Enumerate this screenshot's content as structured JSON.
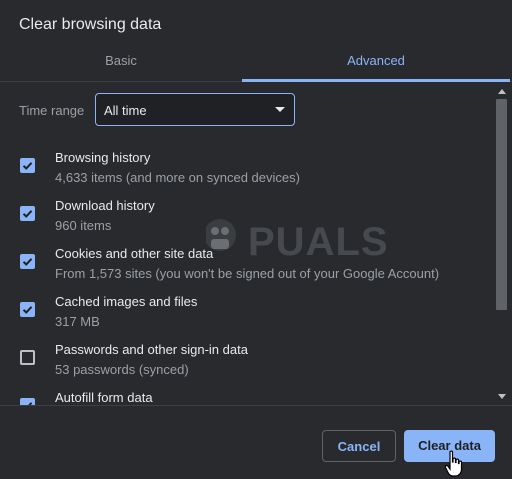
{
  "dialog": {
    "title": "Clear browsing data"
  },
  "tabs": [
    {
      "label": "Basic",
      "active": false
    },
    {
      "label": "Advanced",
      "active": true
    }
  ],
  "time_range": {
    "label": "Time range",
    "value": "All time"
  },
  "items": [
    {
      "title": "Browsing history",
      "subtitle": "4,633 items (and more on synced devices)",
      "checked": true
    },
    {
      "title": "Download history",
      "subtitle": "960 items",
      "checked": true
    },
    {
      "title": "Cookies and other site data",
      "subtitle": "From 1,573 sites (you won't be signed out of your Google Account)",
      "checked": true
    },
    {
      "title": "Cached images and files",
      "subtitle": "317 MB",
      "checked": true
    },
    {
      "title": "Passwords and other sign-in data",
      "subtitle": "53 passwords (synced)",
      "checked": false
    },
    {
      "title": "Autofill form data",
      "subtitle": "",
      "checked": true
    }
  ],
  "footer": {
    "cancel_label": "Cancel",
    "clear_label": "Clear data"
  },
  "watermark": {
    "text": "PUALS"
  },
  "colors": {
    "accent": "#8ab4f8",
    "background": "#292a2d",
    "text": "#e8eaed",
    "muted": "#9aa0a6"
  }
}
